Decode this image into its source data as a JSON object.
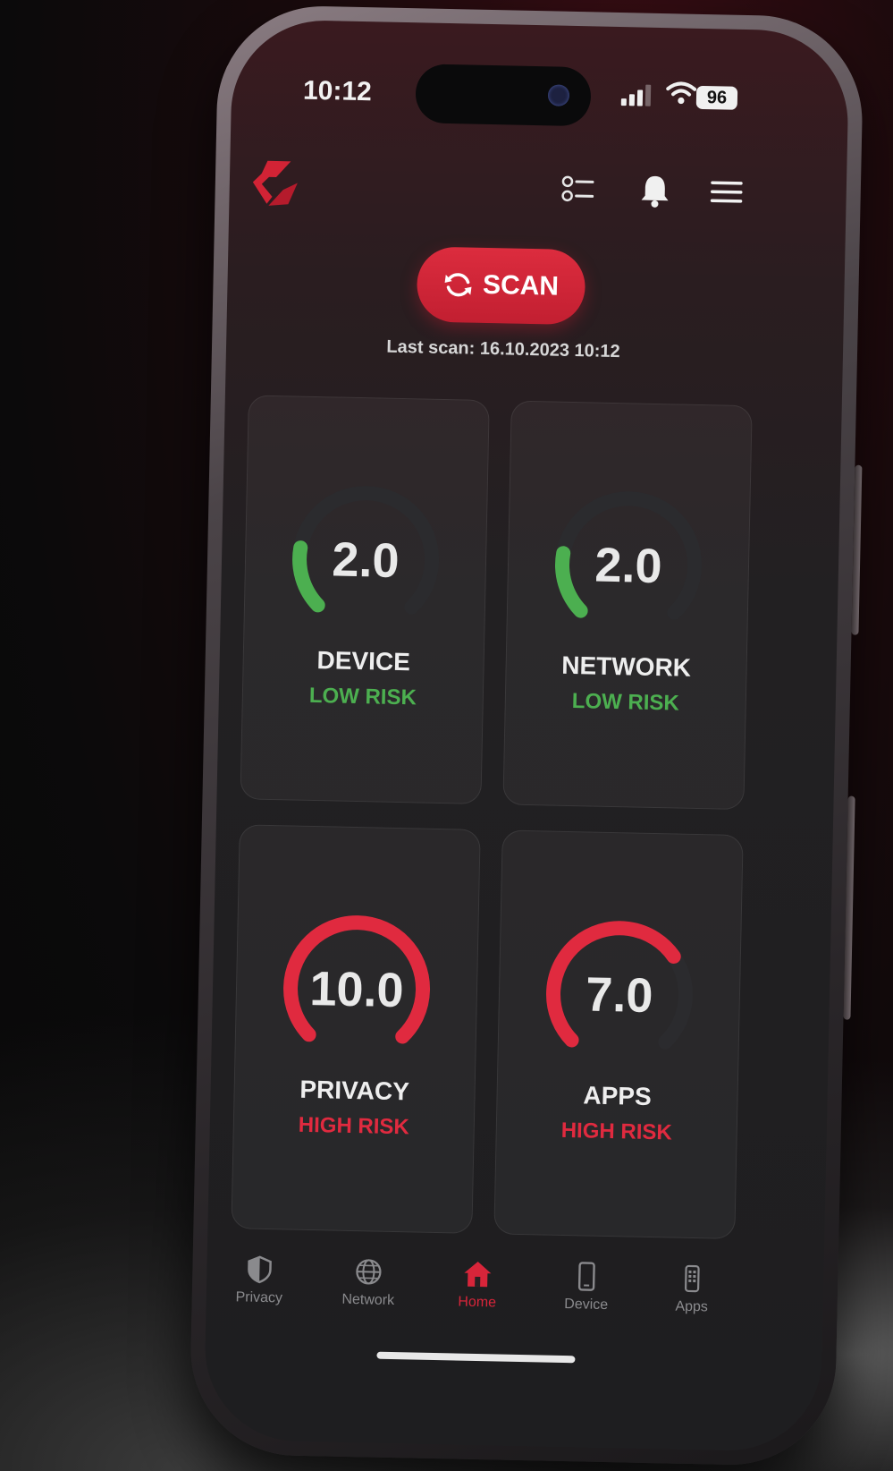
{
  "status_bar": {
    "time": "10:12",
    "battery": "96"
  },
  "topbar": {
    "logo_icon": "app-logo",
    "checklist_icon": "checklist-icon",
    "bell_icon": "bell-icon",
    "menu_icon": "hamburger-menu-icon"
  },
  "scan": {
    "label": "SCAN",
    "icon": "refresh-icon",
    "last_scan": "Last scan: 16.10.2023 10:12"
  },
  "cards": [
    {
      "value": "2.0",
      "score": 2.0,
      "label": "DEVICE",
      "risk": "LOW RISK",
      "risk_color": "#4caf50"
    },
    {
      "value": "2.0",
      "score": 2.0,
      "label": "NETWORK",
      "risk": "LOW RISK",
      "risk_color": "#4caf50"
    },
    {
      "value": "10.0",
      "score": 10.0,
      "label": "PRIVACY",
      "risk": "HIGH RISK",
      "risk_color": "#e02a3f"
    },
    {
      "value": "7.0",
      "score": 7.0,
      "label": "APPS",
      "risk": "HIGH RISK",
      "risk_color": "#e02a3f"
    }
  ],
  "nav": [
    {
      "label": "Privacy",
      "icon": "shield-icon"
    },
    {
      "label": "Network",
      "icon": "globe-icon"
    },
    {
      "label": "Home",
      "icon": "home-icon",
      "active": true
    },
    {
      "label": "Device",
      "icon": "phone-icon"
    },
    {
      "label": "Apps",
      "icon": "apps-icon"
    }
  ],
  "colors": {
    "accent": "#d8253a",
    "low_risk": "#4caf50",
    "high_risk": "#e02a3f",
    "track": "#2b2b2e"
  }
}
